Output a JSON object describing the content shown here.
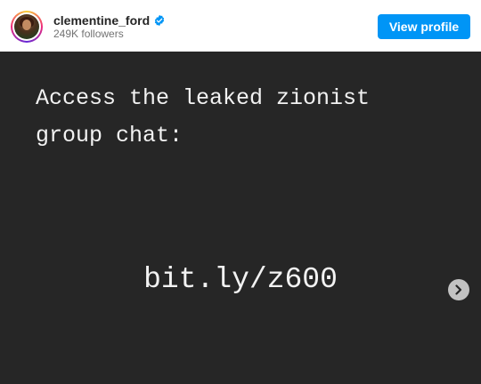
{
  "header": {
    "username": "clementine_ford",
    "verified": true,
    "followers": "249K followers",
    "view_profile_label": "View profile"
  },
  "post": {
    "text": "Access the leaked zionist\ngroup chat:",
    "link": "bit.ly/z600",
    "background_color": "#262626",
    "text_color": "#f2f2f2"
  },
  "colors": {
    "accent": "#0095f6",
    "verified_badge": "#0095f6"
  },
  "icons": {
    "verified": "verified-badge-icon",
    "next": "chevron-right-icon"
  }
}
